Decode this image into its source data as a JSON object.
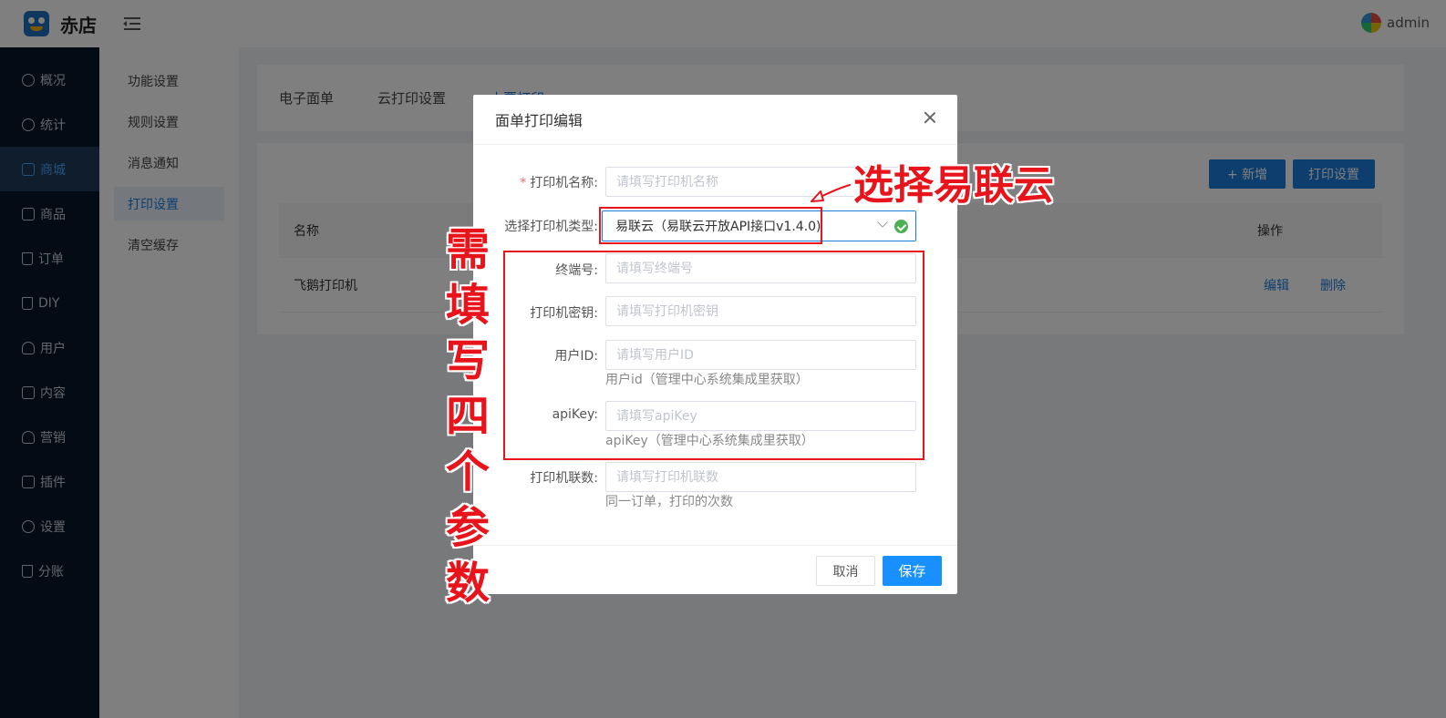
{
  "header": {
    "brand": "赤店",
    "user": "admin"
  },
  "sidemenu": {
    "items": [
      {
        "label": "概况",
        "icon": "dashboard-icon"
      },
      {
        "label": "统计",
        "icon": "stats-icon"
      },
      {
        "label": "商城",
        "icon": "store-icon",
        "active": true
      },
      {
        "label": "商品",
        "icon": "goods-icon"
      },
      {
        "label": "订单",
        "icon": "order-icon"
      },
      {
        "label": "DIY",
        "icon": "diy-icon"
      },
      {
        "label": "用户",
        "icon": "user-icon"
      },
      {
        "label": "内容",
        "icon": "content-icon"
      },
      {
        "label": "营销",
        "icon": "marketing-icon"
      },
      {
        "label": "插件",
        "icon": "plugin-icon"
      },
      {
        "label": "设置",
        "icon": "settings-icon"
      },
      {
        "label": "分账",
        "icon": "split-icon"
      }
    ]
  },
  "submenu": {
    "items": [
      "功能设置",
      "规则设置",
      "消息通知",
      "打印设置",
      "清空缓存"
    ],
    "active_index": 3
  },
  "tabs": [
    "电子面单",
    "云打印设置",
    "小票打印"
  ],
  "toolbar": {
    "add_label": "+ 新增",
    "print_settings_label": "打印设置"
  },
  "table": {
    "headers": {
      "name": "名称",
      "ops": "操作"
    },
    "rows": [
      {
        "name": "飞鹅打印机",
        "edit": "编辑",
        "delete": "删除"
      }
    ]
  },
  "dialog": {
    "title": "面单打印编辑",
    "close": "X",
    "fields": {
      "printer_name": {
        "label": "打印机名称:",
        "placeholder": "请填写打印机名称",
        "required_mark": "*"
      },
      "printer_type": {
        "label": "选择打印机类型:",
        "value": "易联云（易联云开放API接口v1.4.0)"
      },
      "terminal_no": {
        "label": "终端号:",
        "placeholder": "请填写终端号"
      },
      "printer_key": {
        "label": "打印机密钥:",
        "placeholder": "请填写打印机密钥"
      },
      "user_id": {
        "label": "用户ID:",
        "placeholder": "请填写用户ID",
        "hint": "用户id（管理中心系统集成里获取）"
      },
      "api_key": {
        "label": "apiKey:",
        "placeholder": "请填写apiKey",
        "hint": "apiKey（管理中心系统集成里获取）"
      },
      "copies": {
        "label": "打印机联数:",
        "placeholder": "请填写打印机联数",
        "hint": "同一订单，打印的次数"
      }
    },
    "cancel_label": "取消",
    "save_label": "保存"
  },
  "annotations": {
    "select_hint": "选择易联云",
    "fill_hint": "需填写四个参数",
    "color": "#e8141b"
  }
}
